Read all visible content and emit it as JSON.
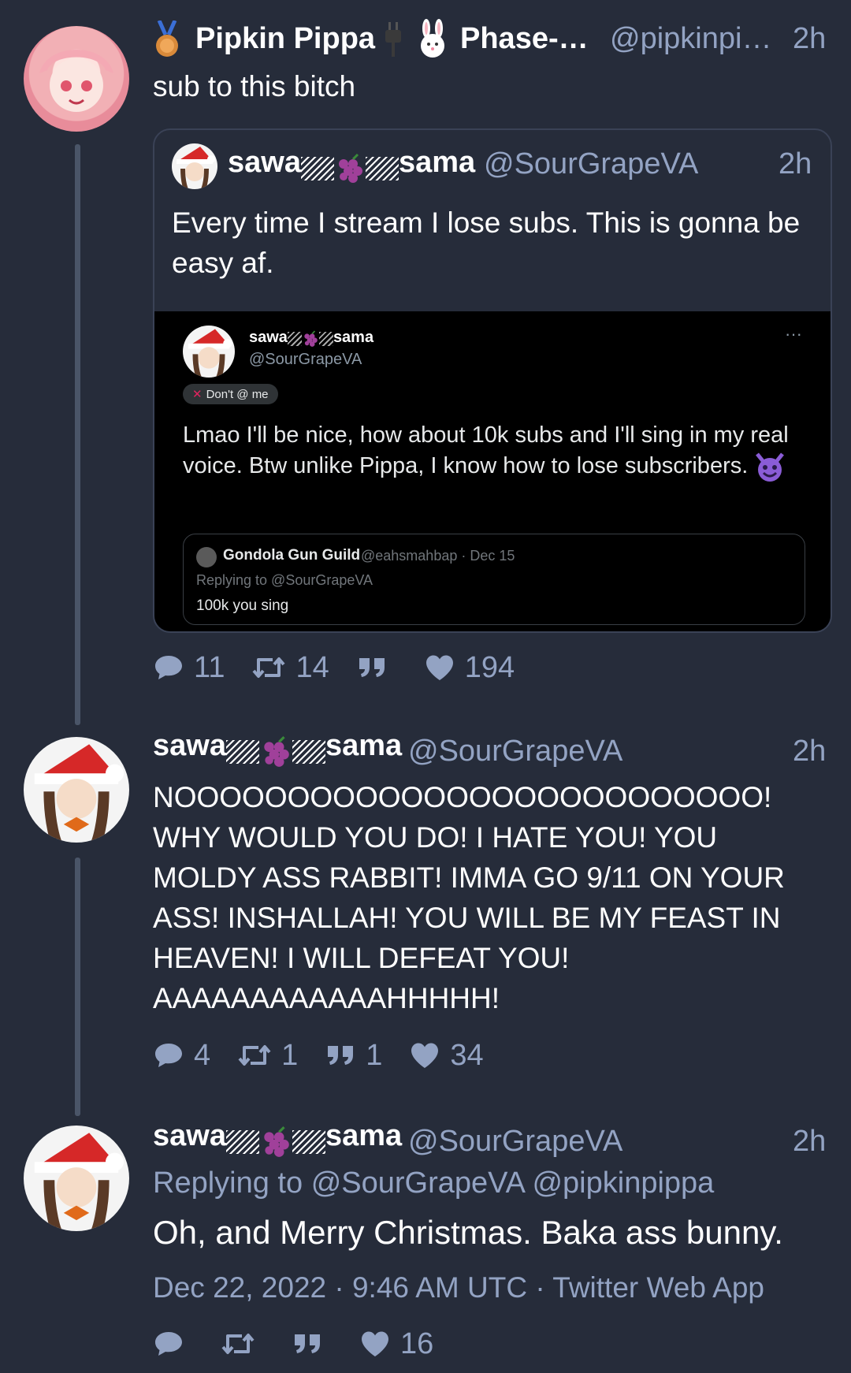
{
  "tweets": [
    {
      "name_left": "Pipkin Pippa",
      "name_right": "Phase-…",
      "handle": "@pipkinpi…",
      "time": "2h",
      "text": "sub to this bitch",
      "quote": {
        "name_a": "sawa",
        "name_b": "sama",
        "handle": "@SourGrapeVA",
        "time": "2h",
        "text": "Every time I stream I lose subs. This is gonna be easy af.",
        "embed": {
          "name_a": "sawa",
          "name_b": "sama",
          "handle": "@SourGrapeVA",
          "more": "···",
          "badge": "Don't @ me",
          "text": "Lmao I'll be nice, how about 10k subs and I'll sing in my real voice. Btw unlike Pippa, I know how to lose subscribers.",
          "reply_name": "Gondola Gun Guild",
          "reply_handle": "@eahsmahbap · Dec 15",
          "reply_to": "Replying to @SourGrapeVA",
          "reply_text": "100k you sing"
        }
      },
      "stats": {
        "replies": "11",
        "retweets": "14",
        "quotes": "",
        "likes": "194"
      }
    },
    {
      "name_a": "sawa",
      "name_b": "sama",
      "handle": "@SourGrapeVA",
      "time": "2h",
      "text": "NOOOOOOOOOOOOOOOOOOOOOOOOOO! WHY WOULD YOU DO! I HATE YOU! YOU MOLDY ASS RABBIT! IMMA GO 9/11 ON YOUR ASS! INSHALLAH! YOU WILL BE MY FEAST IN HEAVEN! I WILL DEFEAT YOU! AAAAAAAAAAAAHHHHH!",
      "stats": {
        "replies": "4",
        "retweets": "1",
        "quotes": "1",
        "likes": "34"
      }
    },
    {
      "name_a": "sawa",
      "name_b": "sama",
      "handle": "@SourGrapeVA",
      "time": "2h",
      "replying_prefix": "Replying to",
      "replying_handles": "@SourGrapeVA @pipkinpippa",
      "text": "Oh, and Merry Christmas. Baka ass bunny.",
      "timestamp": "Dec 22, 2022 · 9:46 AM UTC · Twitter Web App",
      "stats": {
        "replies": "",
        "retweets": "",
        "quotes": "",
        "likes": "16"
      }
    }
  ],
  "colors": {
    "background": "#262c3a",
    "muted": "#93a3c3",
    "embed_bg": "#000000",
    "thread_line": "#4a5568"
  },
  "icons": [
    "medal-icon",
    "plug-icon",
    "bunny-icon",
    "grapes-icon",
    "reply-icon",
    "retweet-icon",
    "quote-icon",
    "heart-icon",
    "devil-emoji-icon",
    "cross-icon"
  ]
}
